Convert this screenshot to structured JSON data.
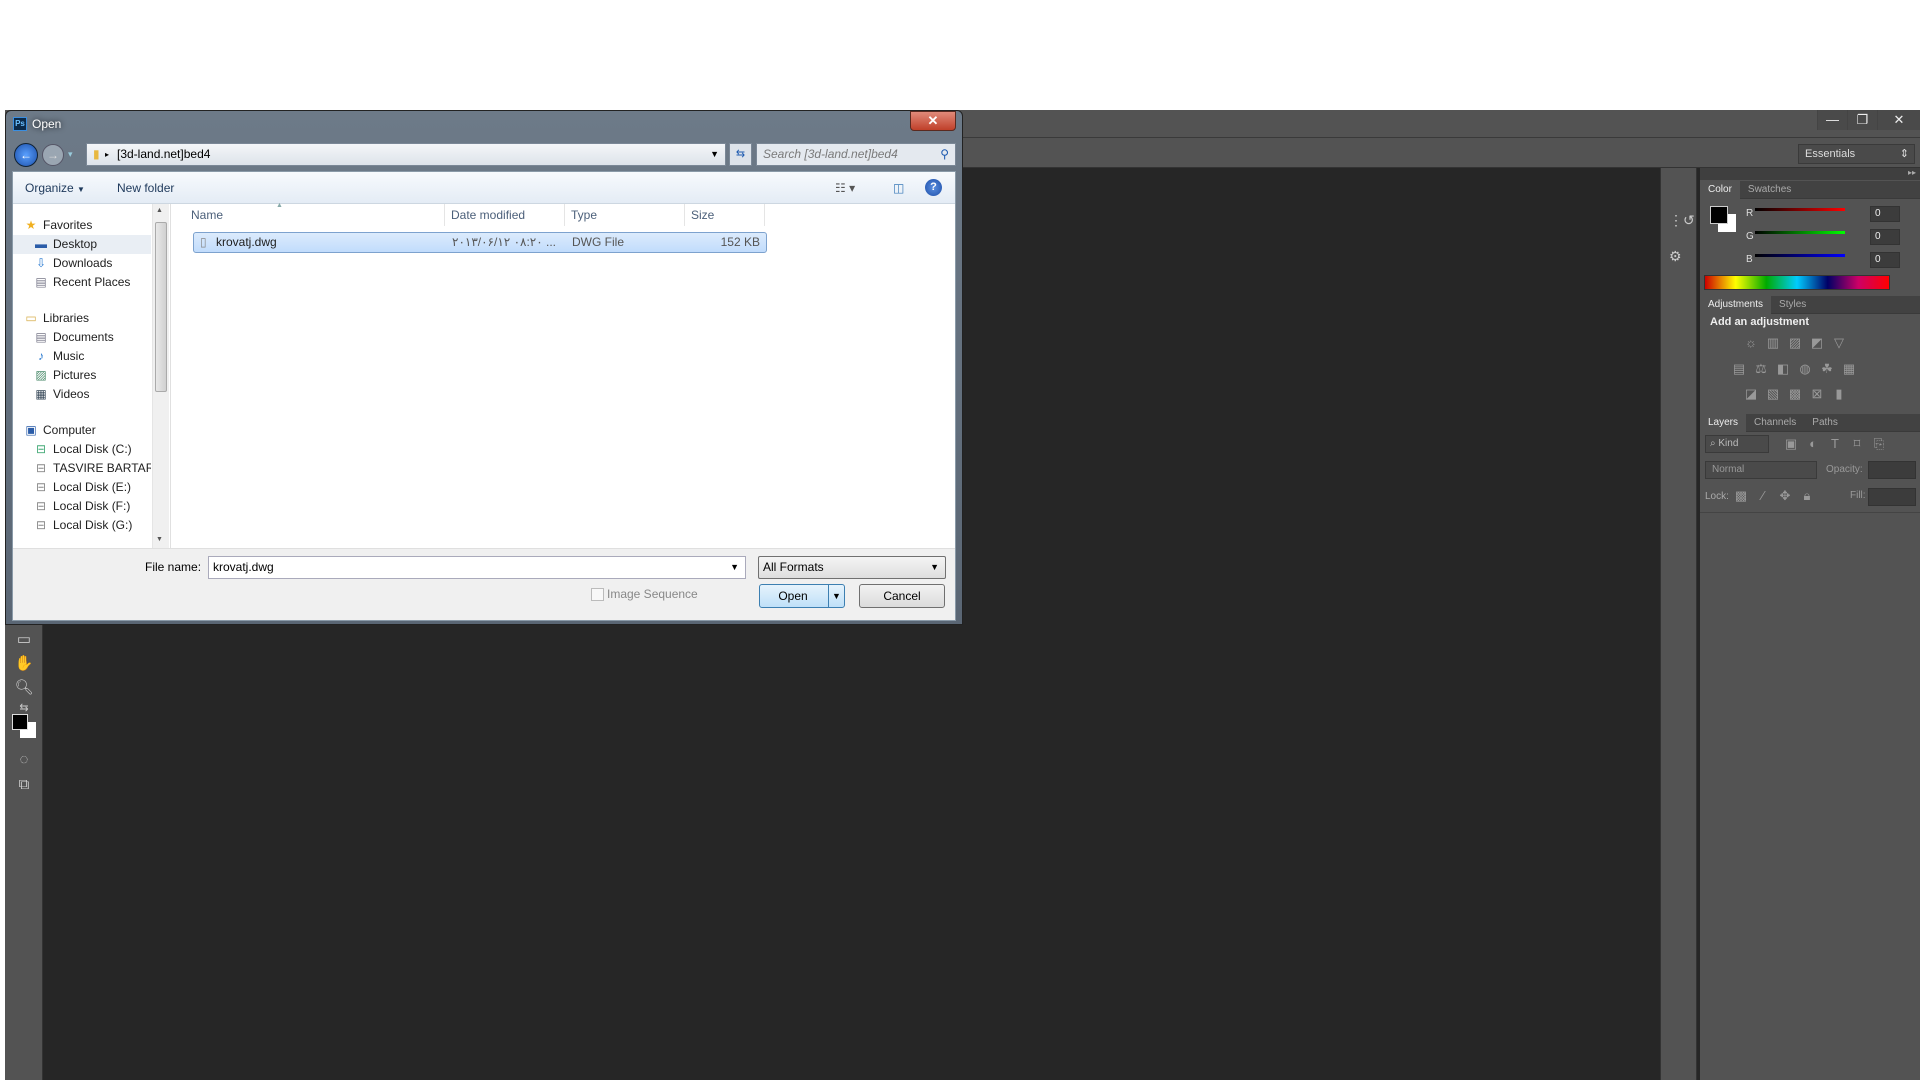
{
  "photoshop": {
    "window_buttons": {
      "minimize": "—",
      "restore": "❐",
      "close": "✕"
    },
    "workspace": "Essentials",
    "panels": {
      "color_tabs": [
        "Color",
        "Swatches"
      ],
      "color": {
        "r_label": "R",
        "g_label": "G",
        "b_label": "B",
        "r": "0",
        "g": "0",
        "b": "0",
        "foreground": "#000000",
        "background": "#ffffff"
      },
      "adjustments_tabs": [
        "Adjustments",
        "Styles"
      ],
      "adjustments_title": "Add an adjustment",
      "layers_tabs": [
        "Layers",
        "Channels",
        "Paths"
      ],
      "kind_label": "Kind",
      "blend_mode": "Normal",
      "opacity_label": "Opacity:",
      "lock_label": "Lock:",
      "fill_label": "Fill:"
    }
  },
  "dialog": {
    "title": "Open",
    "app_icon": "Ps",
    "close": "✕",
    "address": "[3d-land.net]bed4",
    "search_placeholder": "Search [3d-land.net]bed4",
    "toolbar": {
      "organize": "Organize",
      "new_folder": "New folder"
    },
    "nav": {
      "favorites": "Favorites",
      "favorites_items": [
        "Desktop",
        "Downloads",
        "Recent Places"
      ],
      "libraries": "Libraries",
      "libraries_items": [
        "Documents",
        "Music",
        "Pictures",
        "Videos"
      ],
      "computer": "Computer",
      "computer_items": [
        "Local Disk (C:)",
        "TASVIRE BARTAR",
        "Local Disk (E:)",
        "Local Disk (F:)",
        "Local Disk (G:)"
      ]
    },
    "columns": [
      "Name",
      "Date modified",
      "Type",
      "Size"
    ],
    "files": [
      {
        "name": "krovatj.dwg",
        "date": "۲۰۱۳/۰۶/۱۲ ۰۸:۲۰ ...",
        "type": "DWG File",
        "size": "152 KB"
      }
    ],
    "file_name_label": "File name:",
    "file_name": "krovatj.dwg",
    "format": "All Formats",
    "image_sequence": "Image Sequence",
    "image_sequence_checked": false,
    "open": "Open",
    "cancel": "Cancel"
  }
}
